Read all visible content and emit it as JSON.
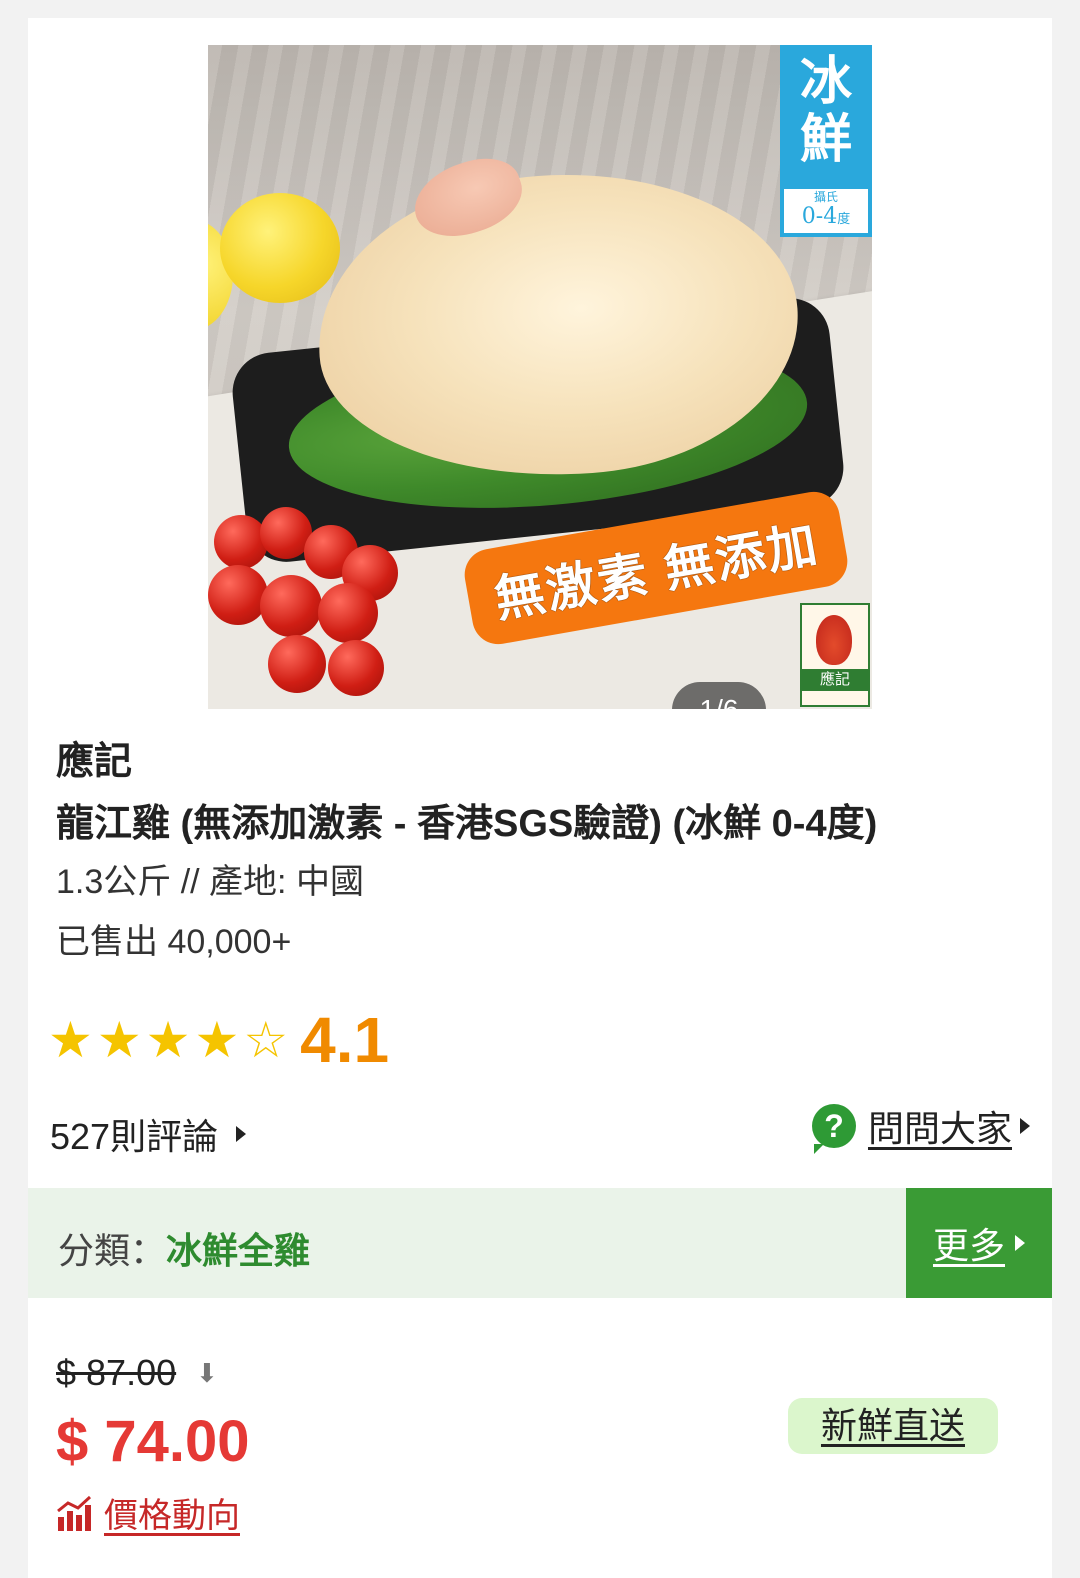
{
  "gallery": {
    "counter": "1/6",
    "badge_cold_big": "冰鮮",
    "badge_cold_small_top": "攝氏",
    "badge_cold_small_range": "0-4",
    "badge_cold_small_unit": "度",
    "promo_text": "無激素 無添加",
    "logo_name": "應記"
  },
  "product": {
    "brand": "應記",
    "title": "龍江雞 (無添加激素 - 香港SGS驗證) (冰鮮 0-4度)",
    "spec": "1.3公斤 // 產地: 中國",
    "sold": "已售出 40,000+"
  },
  "rating": {
    "score": "4.1",
    "stars_filled": 4,
    "stars_total": 5,
    "reviews_label": "527則評論"
  },
  "ask": {
    "label": "問問大家"
  },
  "category": {
    "label": "分類：",
    "value": "冰鮮全雞",
    "more_label": "更多"
  },
  "pricing": {
    "original_price": "$ 87.00",
    "price": "$ 74.00",
    "fresh_badge": "新鮮直送",
    "trend_label": "價格動向"
  },
  "colors": {
    "accent_green": "#3a9b35",
    "price_red": "#e53935",
    "score_orange": "#f08a00",
    "star_yellow": "#f5c400"
  }
}
